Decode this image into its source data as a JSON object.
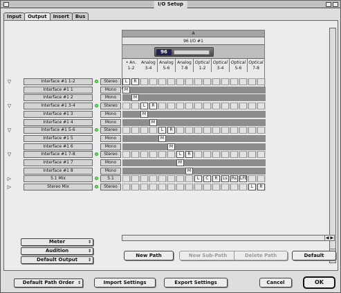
{
  "window": {
    "title": "I/O Setup"
  },
  "tabs": [
    {
      "label": "Input",
      "active": false
    },
    {
      "label": "Output",
      "active": true
    },
    {
      "label": "Insert",
      "active": false
    },
    {
      "label": "Bus",
      "active": false
    }
  ],
  "grid": {
    "bus_label": "A",
    "interface_label": "96 I/O #1",
    "device_logo": "96",
    "channel_headers": [
      {
        "top": "• An.",
        "bottom": "1-2"
      },
      {
        "top": "Analog",
        "bottom": "3-4"
      },
      {
        "top": "Analog",
        "bottom": "5-6"
      },
      {
        "top": "Analog",
        "bottom": "7-8"
      },
      {
        "top": "Optical",
        "bottom": "1-2"
      },
      {
        "top": "Optical",
        "bottom": "3-4"
      },
      {
        "top": "Optical",
        "bottom": "5-6"
      },
      {
        "top": "Optical",
        "bottom": "7-8"
      }
    ]
  },
  "paths": [
    {
      "name": "Interface #1 1-2",
      "format": "Stereo",
      "expandable": true,
      "led": true
    },
    {
      "name": "Interface #1 1",
      "format": "Mono",
      "expandable": false,
      "led": false
    },
    {
      "name": "Interface #1 2",
      "format": "Mono",
      "expandable": false,
      "led": false
    },
    {
      "name": "Interface #1 3-4",
      "format": "Stereo",
      "expandable": true,
      "led": true
    },
    {
      "name": "Interface #1 3",
      "format": "Mono",
      "expandable": false,
      "led": false
    },
    {
      "name": "Interface #1 4",
      "format": "Mono",
      "expandable": false,
      "led": false
    },
    {
      "name": "Interface #1 5-6",
      "format": "Stereo",
      "expandable": true,
      "led": true
    },
    {
      "name": "Interface #1 5",
      "format": "Mono",
      "expandable": false,
      "led": false
    },
    {
      "name": "Interface #1 6",
      "format": "Mono",
      "expandable": false,
      "led": false
    },
    {
      "name": "Interface #1 7-8",
      "format": "Stereo",
      "expandable": true,
      "led": true
    },
    {
      "name": "Interface #1 7",
      "format": "Mono",
      "expandable": false,
      "led": false
    },
    {
      "name": "Interface #1 8",
      "format": "Mono",
      "expandable": false,
      "led": false
    },
    {
      "name": "5.1 Mix",
      "format": "5.1",
      "expandable": true,
      "led": true
    },
    {
      "name": "Stereo Mix",
      "format": "Stereo",
      "expandable": true,
      "led": true
    }
  ],
  "assignments": {
    "row0": [
      "L",
      "R"
    ],
    "row1": [
      "M"
    ],
    "row2": [
      "M"
    ],
    "row3": [
      "L",
      "R"
    ],
    "row4": [
      "M"
    ],
    "row5": [
      "M"
    ],
    "row6": [
      "L",
      "R"
    ],
    "row7": [
      "M"
    ],
    "row8": [
      "M"
    ],
    "row9": [
      "L",
      "R"
    ],
    "row10": [
      "M"
    ],
    "row11": [
      "M"
    ],
    "row12": [
      "L",
      "C",
      "R",
      "Ls",
      "Rs",
      "LFE"
    ],
    "row13": [
      "L",
      "R"
    ]
  },
  "popups": {
    "meter": "Meter",
    "audition": "Audition",
    "default_output": "Default Output",
    "default_path_order": "Default Path Order"
  },
  "buttons": {
    "new_path": "New Path",
    "new_sub_path": "New Sub-Path",
    "delete_path": "Delete Path",
    "default": "Default",
    "import_settings": "Import Settings",
    "export_settings": "Export Settings",
    "cancel": "Cancel",
    "ok": "OK"
  },
  "icons": {
    "expander": "disclosure-triangle-icon",
    "scroll_up": "arrow-up-icon",
    "scroll_down": "arrow-down-icon",
    "scroll_left": "arrow-left-icon",
    "scroll_right": "arrow-right-icon"
  },
  "colors": {
    "led": "#55ee55",
    "grid_dark": "#8c8c8c"
  }
}
